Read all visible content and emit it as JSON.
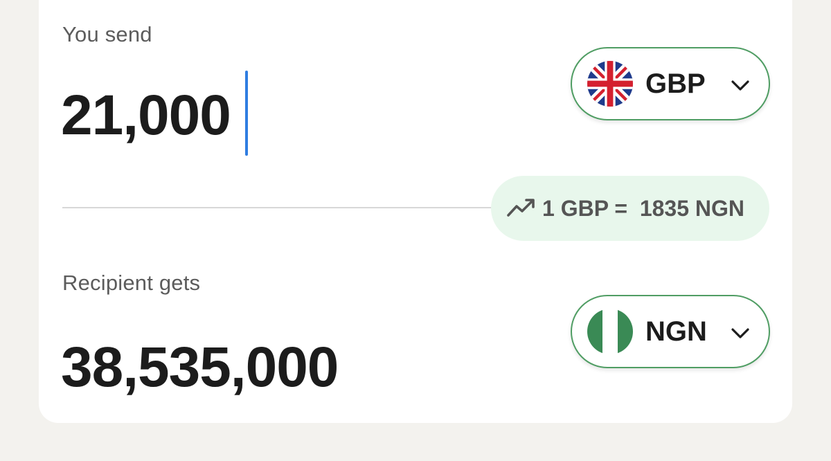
{
  "send": {
    "label": "You send",
    "amount": "21,000",
    "currency": {
      "code": "GBP",
      "flag": "uk-flag-icon"
    }
  },
  "rate": {
    "text": "1 GBP =  1835 NGN",
    "icon": "trending-up-icon"
  },
  "receive": {
    "label": "Recipient gets",
    "amount": "38,535,000",
    "currency": {
      "code": "NGN",
      "flag": "nigeria-flag-icon"
    }
  },
  "colors": {
    "accent_border": "#4f9d63",
    "rate_bg": "#e8f7ec",
    "caret": "#2f7de1",
    "page_bg": "#f3f2ee"
  }
}
